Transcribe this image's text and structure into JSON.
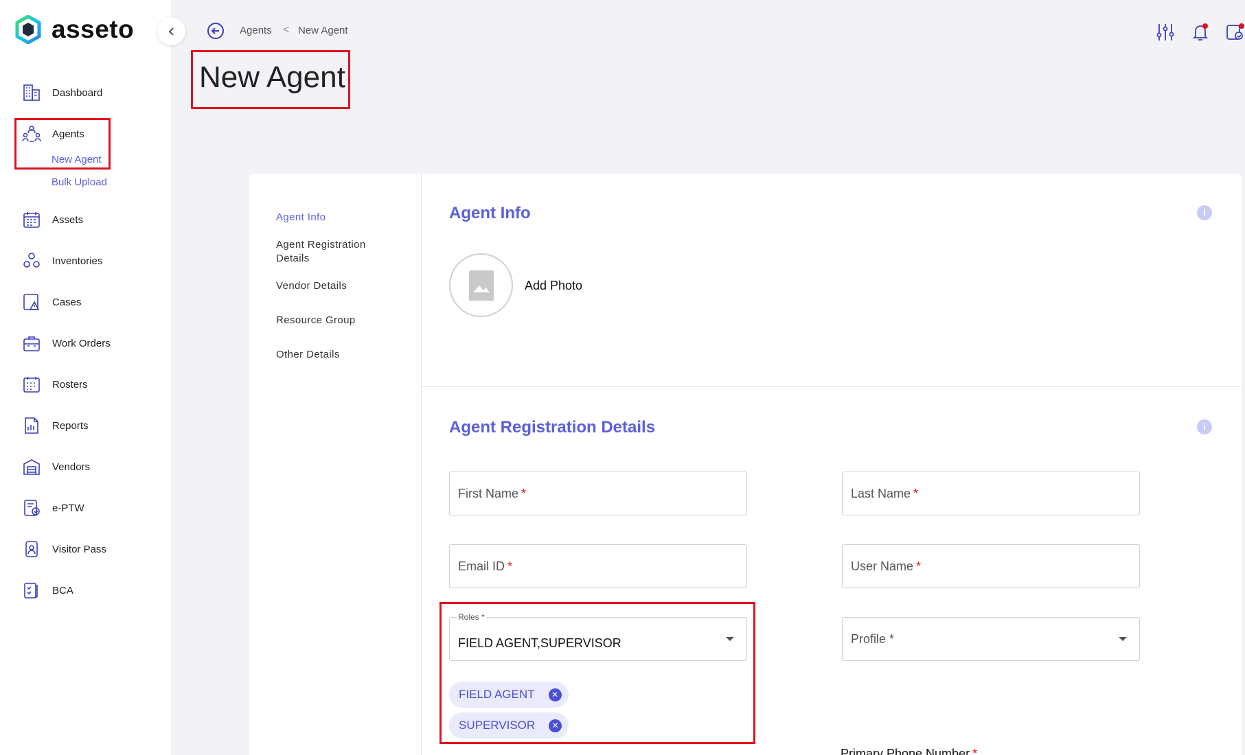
{
  "app": {
    "name": "asseto"
  },
  "sidebar": {
    "items": [
      {
        "label": "Dashboard",
        "icon": "building-icon"
      },
      {
        "label": "Agents",
        "icon": "agents-icon"
      },
      {
        "label": "Assets",
        "icon": "assets-icon"
      },
      {
        "label": "Inventories",
        "icon": "inventories-icon"
      },
      {
        "label": "Cases",
        "icon": "cases-icon"
      },
      {
        "label": "Work Orders",
        "icon": "briefcase-icon"
      },
      {
        "label": "Rosters",
        "icon": "calendar-icon"
      },
      {
        "label": "Reports",
        "icon": "reports-icon"
      },
      {
        "label": "Vendors",
        "icon": "vendors-icon"
      },
      {
        "label": "e-PTW",
        "icon": "eptw-icon"
      },
      {
        "label": "Visitor Pass",
        "icon": "visitor-pass-icon"
      },
      {
        "label": "BCA",
        "icon": "bca-icon"
      }
    ],
    "sub_items": [
      {
        "label": "New Agent",
        "active": true
      },
      {
        "label": "Bulk Upload",
        "active": false
      }
    ]
  },
  "breadcrumb": {
    "parent": "Agents",
    "separator": "<",
    "current": "New Agent"
  },
  "page": {
    "title": "New Agent"
  },
  "sections_nav": [
    {
      "label": "Agent Info",
      "active": true
    },
    {
      "label": "Agent Registration Details",
      "active": false
    },
    {
      "label": "Vendor Details",
      "active": false
    },
    {
      "label": "Resource Group",
      "active": false
    },
    {
      "label": "Other Details",
      "active": false
    }
  ],
  "agent_info": {
    "title": "Agent Info",
    "add_photo": "Add Photo"
  },
  "registration": {
    "title": "Agent Registration Details",
    "first_name": "First Name",
    "last_name": "Last Name",
    "email": "Email ID",
    "user_name": "User Name",
    "required_mark": "*",
    "roles": {
      "label": "Roles *",
      "value": "FIELD AGENT,SUPERVISOR"
    },
    "profile": {
      "placeholder": "Profile *"
    },
    "chips": [
      "FIELD AGENT",
      "SUPERVISOR"
    ],
    "primary_phone": "Primary Phone Number"
  },
  "info_glyph": "i",
  "colors": {
    "accent": "#5a5fe0",
    "highlight": "#e1121f",
    "required": "#e1121f"
  }
}
